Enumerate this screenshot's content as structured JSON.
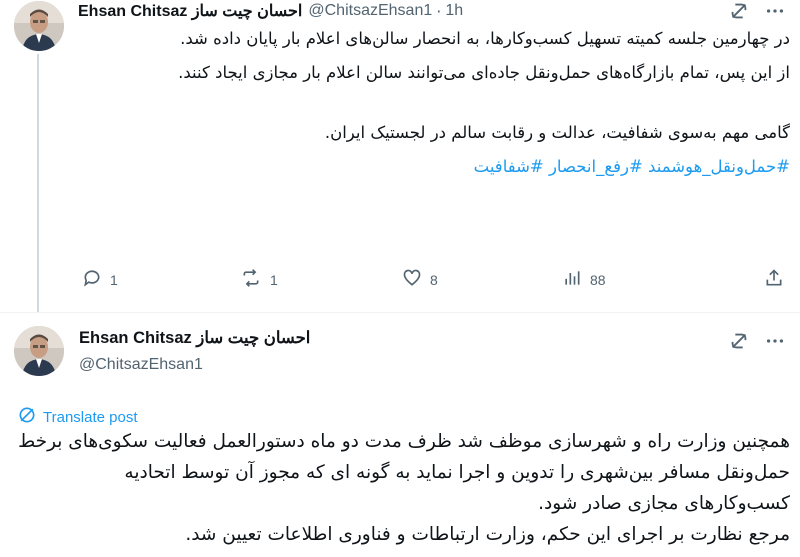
{
  "tweet1": {
    "author_name": "Ehsan Chitsaz احسان چیت ساز",
    "handle": "@ChitsazEhsan1",
    "separator": "·",
    "time": "1h",
    "body": [
      "در چهارمین جلسه کمیته تسهیل کسب‌وکارها، به انحصار سالن‌های اعلام بار پایان داده شد.",
      "از این پس، تمام بازارگاه‌های حمل‌ونقل جاده‌ای می‌توانند سالن  اعلام بار مجازی ایجاد کنند.",
      "",
      "گامی مهم به‌سوی شفافیت، عدالت و رقابت سالم در لجستیک ایران."
    ],
    "hashtags": "#حمل‌ونقل_هوشمند #رفع_انحصار #شفافیت",
    "actions": {
      "replies": "1",
      "reposts": "1",
      "likes": "8",
      "views": "88"
    }
  },
  "tweet2": {
    "author_name": "Ehsan Chitsaz احسان چیت ساز",
    "handle": "@ChitsazEhsan1",
    "translate_label": "Translate post",
    "body": [
      "همچنین وزارت راه و شهرسازی موظف شد ظرف مدت دو ماه دستورالعمل فعالیت سکوی‌های برخط حمل‌ونقل مسافر بین‌شهری را تدوین و اجرا نماید به گونه ای که مجوز آن  توسط اتحادیه کسب‌وکارهای مجازی صادر شود.",
      "مرجع نظارت بر اجرای این حکم، وزارت ارتباطات و فناوری اطلاعات تعیین شد."
    ]
  },
  "icons": {
    "grok": "grok-icon",
    "more": "more-icon",
    "reply": "reply-icon",
    "repost": "repost-icon",
    "like": "like-icon",
    "views": "views-icon",
    "share": "share-icon",
    "translate": "translate-icon"
  },
  "colors": {
    "link": "#1d9bf0",
    "secondary_text": "#536471",
    "primary_text": "#0f1419",
    "divider": "#eff3f4"
  }
}
